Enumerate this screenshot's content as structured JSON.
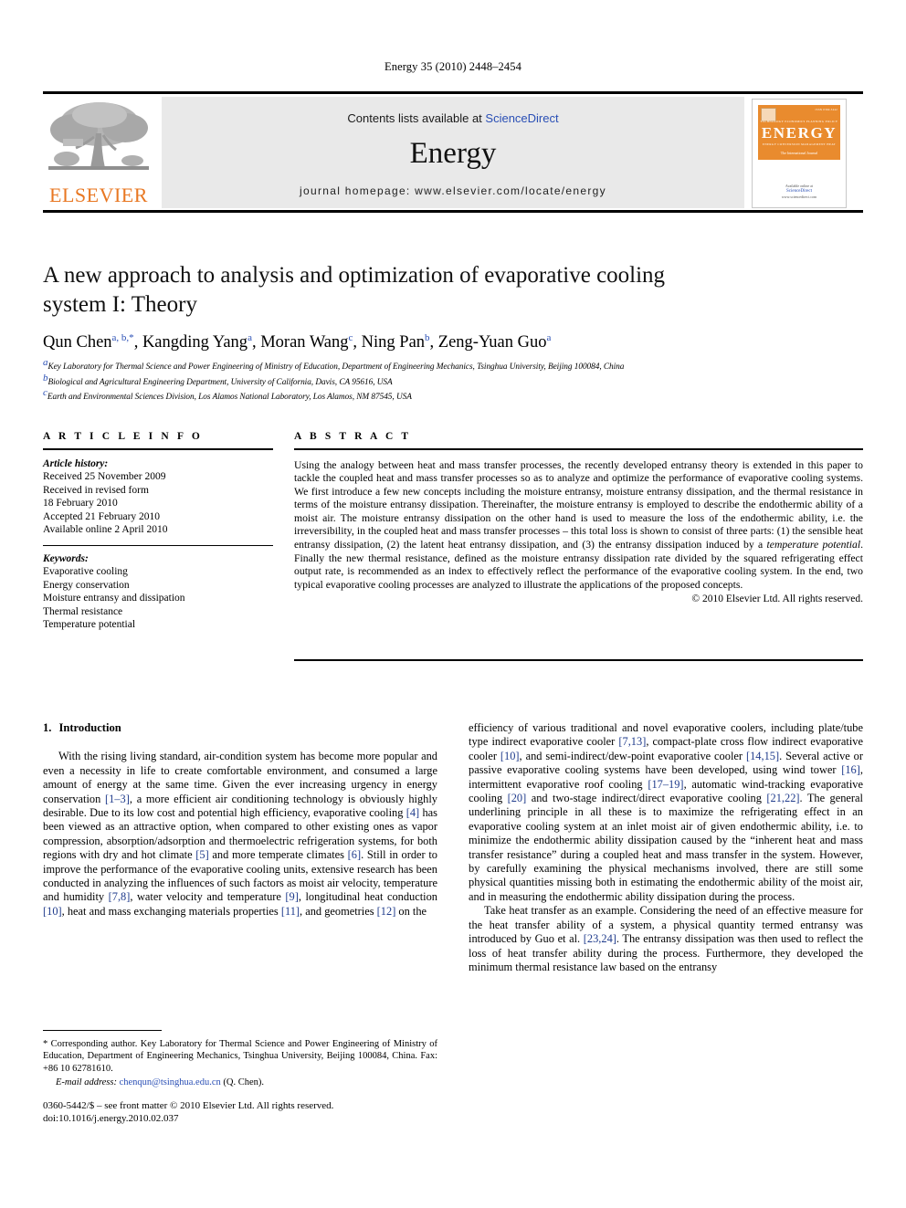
{
  "running_head": "Energy 35 (2010) 2448–2454",
  "masthead": {
    "contents_text": "Contents lists available at ",
    "sciencedirect": "ScienceDirect",
    "journal_name": "Energy",
    "homepage": "journal homepage: www.elsevier.com/locate/energy",
    "publisher_logo_word": "ELSEVIER",
    "cover": {
      "title": "ENERGY",
      "subtitle": "The International Journal",
      "issue_label": "ISSN 0360-5442",
      "top_microtext": "TECHNOLOGY      ECONOMICS      PLANNING      POLICY",
      "bottom_microtext": "ENERGY      CONVERSION      MANAGEMENT      HEAT",
      "available_text": "Available online at",
      "sciencedirect": "ScienceDirect",
      "url": "www.sciencedirect.com"
    },
    "accent_orange": "#E87722",
    "link_blue": "#2a4fb5"
  },
  "article": {
    "title": "A new approach to analysis and optimization of evaporative cooling system I: Theory",
    "authors": [
      {
        "name": "Qun Chen",
        "marks": "a, b,*"
      },
      {
        "name": "Kangding Yang",
        "marks": "a"
      },
      {
        "name": "Moran Wang",
        "marks": "c"
      },
      {
        "name": "Ning Pan",
        "marks": "b"
      },
      {
        "name": "Zeng-Yuan Guo",
        "marks": "a"
      }
    ],
    "affiliations": [
      {
        "mark": "a",
        "text": "Key Laboratory for Thermal Science and Power Engineering of Ministry of Education, Department of Engineering Mechanics, Tsinghua University, Beijing 100084, China"
      },
      {
        "mark": "b",
        "text": "Biological and Agricultural Engineering Department, University of California, Davis, CA 95616, USA"
      },
      {
        "mark": "c",
        "text": "Earth and Environmental Sciences Division, Los Alamos National Laboratory, Los Alamos, NM 87545, USA"
      }
    ]
  },
  "article_info": {
    "heading": "A R T I C L E   I N F O",
    "history_label": "Article history:",
    "history": [
      "Received 25 November 2009",
      "Received in revised form",
      "18 February 2010",
      "Accepted 21 February 2010",
      "Available online 2 April 2010"
    ],
    "keywords_label": "Keywords:",
    "keywords": [
      "Evaporative cooling",
      "Energy conservation",
      "Moisture entransy and dissipation",
      "Thermal resistance",
      "Temperature potential"
    ]
  },
  "abstract": {
    "heading": "A B S T R A C T",
    "part1": "Using the analogy between heat and mass transfer processes, the recently developed entransy theory is extended in this paper to tackle the coupled heat and mass transfer processes so as to analyze and optimize the performance of evaporative cooling systems. We first introduce a few new concepts including the moisture entransy, moisture entransy dissipation, and the thermal resistance in terms of the moisture entransy dissipation. Thereinafter, the moisture entransy is employed to describe the endothermic ability of a moist air. The moisture entransy dissipation on the other hand is used to measure the loss of the endothermic ability, i.e. the irreversibility, in the coupled heat and mass transfer processes – this total loss is shown to consist of three parts: (1) the sensible heat entransy dissipation, (2) the latent heat entransy dissipation, and (3) the entransy dissipation induced by a ",
    "italic1": "temperature potential",
    "part2": ". Finally the new thermal resistance, defined as the moisture entransy dissipation rate divided by the squared refrigerating effect output rate, is recommended as an index to effectively reflect the performance of the evaporative cooling system. In the end, two typical evaporative cooling processes are analyzed to illustrate the applications of the proposed concepts.",
    "copyright": "© 2010 Elsevier Ltd. All rights reserved."
  },
  "introduction": {
    "number": "1.",
    "heading": "Introduction",
    "left_paragraph_html": "With the rising living standard, air-condition system has become more popular and even a necessity in life to create comfortable environment, and consumed a large amount of energy at the same time. Given the ever increasing urgency in energy conservation <span class=\"ref\">[1–3]</span>, a more efficient air conditioning technology is obviously highly desirable. Due to its low cost and potential high efficiency, evaporative cooling <span class=\"ref\">[4]</span> has been viewed as an attractive option, when compared to other existing ones as vapor compression, absorption/adsorption and thermoelectric refrigeration systems, for both regions with dry and hot climate <span class=\"ref\">[5]</span> and more temperate climates <span class=\"ref\">[6]</span>. Still in order to improve the performance of the evaporative cooling units, extensive research has been conducted in analyzing the influences of such factors as moist air velocity, temperature and humidity <span class=\"ref\">[7,8]</span>, water velocity and temperature <span class=\"ref\">[9]</span>, longitudinal heat conduction <span class=\"ref\">[10]</span>, heat and mass exchanging materials properties <span class=\"ref\">[11]</span>, and geometries <span class=\"ref\">[12]</span> on the",
    "right_paragraph1_html": "efficiency of various traditional and novel evaporative coolers, including plate/tube type indirect evaporative cooler <span class=\"ref\">[7,13]</span>, compact-plate cross flow indirect evaporative cooler <span class=\"ref\">[10]</span>, and semi-indirect/dew-point evaporative cooler <span class=\"ref\">[14,15]</span>. Several active or passive evaporative cooling systems have been developed, using wind tower <span class=\"ref\">[16]</span>, intermittent evaporative roof cooling <span class=\"ref\">[17–19]</span>, automatic wind-tracking evaporative cooling <span class=\"ref\">[20]</span> and two-stage indirect/direct evaporative cooling <span class=\"ref\">[21,22]</span>. The general underlining principle in all these is to maximize the refrigerating effect in an evaporative cooling system at an inlet moist air of given endothermic ability, i.e. to minimize the endothermic ability dissipation caused by the “inherent heat and mass transfer resistance” during a coupled heat and mass transfer in the system. However, by carefully examining the physical mechanisms involved, there are still some physical quantities missing both in estimating the endothermic ability of the moist air, and in measuring the endothermic ability dissipation during the process.",
    "right_paragraph2_html": "Take heat transfer as an example. Considering the need of an effective measure for the heat transfer ability of a system, a physical quantity termed entransy was introduced by Guo et al. <span class=\"ref\">[23,24]</span>. The entransy dissipation was then used to reflect the loss of heat transfer ability during the process. Furthermore, they developed the minimum thermal resistance law based on the entransy"
  },
  "footnote": {
    "text": "* Corresponding author. Key Laboratory for Thermal Science and Power Engineering of Ministry of Education, Department of Engineering Mechanics, Tsinghua University, Beijing 100084, China. Fax: +86 10 62781610.",
    "email_label": "E-mail address:",
    "email": "chenqun@tsinghua.edu.cn",
    "email_owner": "(Q. Chen)."
  },
  "page_footer": {
    "line1": "0360-5442/$ – see front matter © 2010 Elsevier Ltd. All rights reserved.",
    "line2": "doi:10.1016/j.energy.2010.02.037"
  }
}
